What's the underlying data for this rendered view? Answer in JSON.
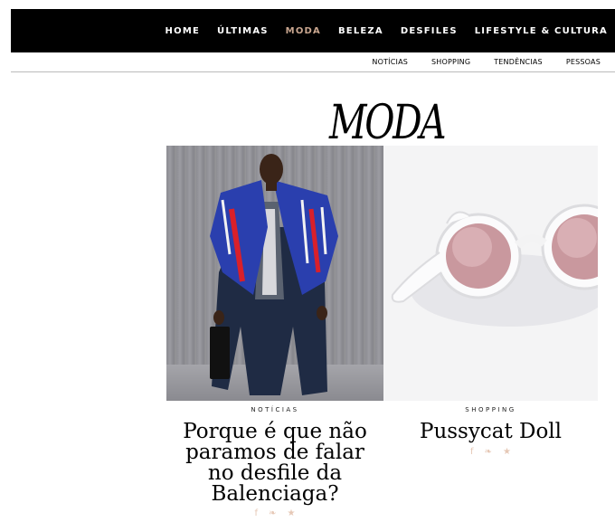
{
  "nav": {
    "items": [
      {
        "label": "HOME"
      },
      {
        "label": "ÚLTIMAS"
      },
      {
        "label": "MODA",
        "active": true
      },
      {
        "label": "BELEZA"
      },
      {
        "label": "DESFILES"
      },
      {
        "label": "LIFESTYLE & CULTURA"
      }
    ],
    "active_color": "#c9a68f"
  },
  "subnav": {
    "items": [
      {
        "label": "NOTÍCIAS"
      },
      {
        "label": "SHOPPING"
      },
      {
        "label": "TENDÊNCIAS"
      },
      {
        "label": "PESSOAS"
      }
    ]
  },
  "page": {
    "title": "MODA"
  },
  "cards": [
    {
      "category": "NOTÍCIAS",
      "title_lines": [
        "Porque é que não",
        "paramos de falar",
        "no desfile da",
        "Balenciaga?"
      ],
      "share_icons": [
        "facebook-icon",
        "twitter-icon",
        "star-icon"
      ]
    },
    {
      "category": "SHOPPING",
      "title_lines": [
        "Pussycat Doll"
      ],
      "share_icons": [
        "facebook-icon",
        "twitter-icon",
        "star-icon"
      ]
    }
  ],
  "share_glyphs": {
    "facebook": "f",
    "twitter": "🐦",
    "star": "★"
  },
  "colors": {
    "share": "#e6c8b6",
    "topbar": "#000000"
  }
}
